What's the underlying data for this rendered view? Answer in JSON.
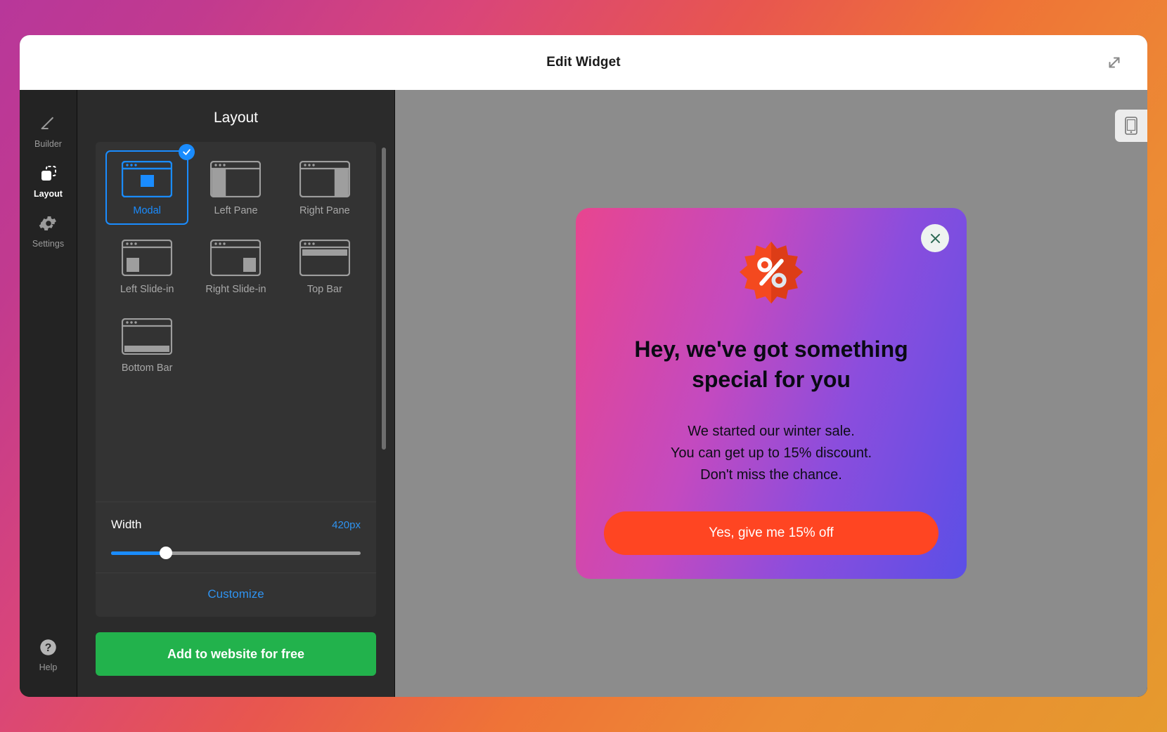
{
  "header": {
    "title": "Edit Widget",
    "expand_icon": "expand-diagonal-icon"
  },
  "rail": {
    "items": [
      {
        "label": "Builder",
        "icon": "pencil-icon",
        "active": false
      },
      {
        "label": "Layout",
        "icon": "layout-square-icon",
        "active": true
      },
      {
        "label": "Settings",
        "icon": "gear-icon",
        "active": false
      }
    ],
    "help": {
      "label": "Help",
      "icon": "question-circle-icon"
    }
  },
  "panel": {
    "title": "Layout",
    "options": [
      {
        "label": "Modal",
        "thumb": "modal-thumb",
        "selected": true
      },
      {
        "label": "Left Pane",
        "thumb": "left-pane-thumb",
        "selected": false
      },
      {
        "label": "Right Pane",
        "thumb": "right-pane-thumb",
        "selected": false
      },
      {
        "label": "Left Slide-in",
        "thumb": "left-slidein-thumb",
        "selected": false
      },
      {
        "label": "Right Slide-in",
        "thumb": "right-slidein-thumb",
        "selected": false
      },
      {
        "label": "Top Bar",
        "thumb": "top-bar-thumb",
        "selected": false
      },
      {
        "label": "Bottom Bar",
        "thumb": "bottom-bar-thumb",
        "selected": false
      }
    ],
    "width": {
      "label": "Width",
      "value": "420px",
      "percent": 22
    },
    "customize_label": "Customize",
    "add_button_label": "Add to website for free"
  },
  "preview": {
    "mobile_toggle_icon": "mobile-phone-icon",
    "widget": {
      "close_icon": "close-x-icon",
      "badge_icon": "percent-starburst-icon",
      "title": "Hey, we've got something special for you",
      "description_lines": [
        "We started our winter sale.",
        "You can get up to 15% discount.",
        "Don't miss the chance."
      ],
      "cta_label": "Yes, give me 15% off"
    }
  },
  "colors": {
    "accent_blue": "#1a8cff",
    "cta_green": "#22b24c",
    "widget_cta_orange": "#ff4522",
    "panel_bg": "#2b2b2b",
    "preview_bg": "#8c8c8c"
  }
}
